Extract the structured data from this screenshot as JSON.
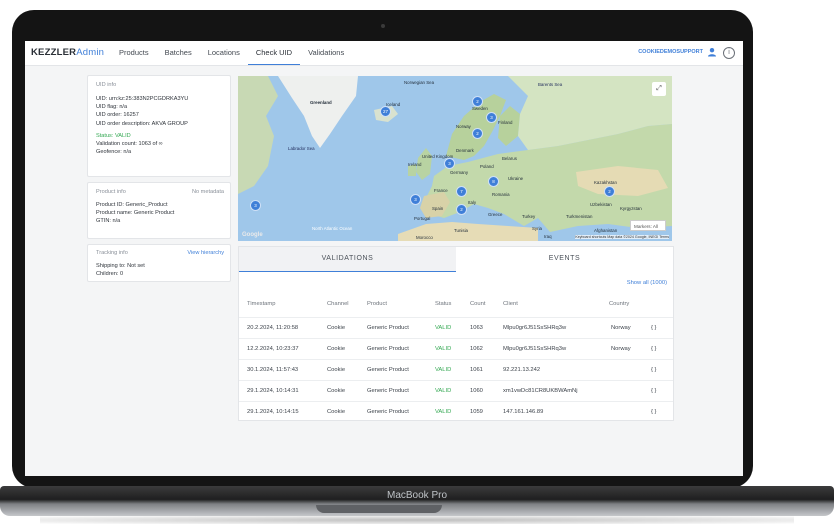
{
  "device": {
    "label": "MacBook Pro"
  },
  "header": {
    "logo_main": "KEZZLER",
    "logo_accent": "Admin",
    "nav": [
      "Products",
      "Batches",
      "Locations",
      "Check UID",
      "Validations"
    ],
    "active_nav": "Check UID",
    "user": "COOKIEDEMOSUPPORT"
  },
  "uid_info": {
    "title": "UID info",
    "uid": "UID: urn:kz:25:383N2PCGDRKA3YU",
    "flag": "UID flag: n/a",
    "order": "UID order: 16257",
    "order_desc": "UID order description: AKVA GROUP",
    "status": "Status: VALID",
    "validation_count": "Validation count: 1063 of ∞",
    "geofence": "Geofence: n/a"
  },
  "product_info": {
    "title": "Product info",
    "meta": "No metadata",
    "id": "Product ID: Generic_Product",
    "name": "Product name: Generic Product",
    "gtin": "GTIN: n/a"
  },
  "tracking_info": {
    "title": "Tracking info",
    "link": "View hierarchy",
    "shipping": "Shipping to: Not set",
    "children": "Children: 0"
  },
  "map": {
    "labels": [
      "Greenland",
      "Iceland",
      "Norwegian Sea",
      "Sweden",
      "Finland",
      "Norway",
      "Denmark",
      "United Kingdom",
      "Ireland",
      "Poland",
      "Belarus",
      "Germany",
      "Ukraine",
      "France",
      "Romania",
      "Kazakhstan",
      "Italy",
      "Spain",
      "Portugal",
      "Greece",
      "Turkey",
      "Turkmenistan",
      "Uzbekistan",
      "Kyrgyzstan",
      "Syria",
      "Iraq",
      "Afghanistan",
      "Tunisia",
      "Morocco",
      "North Atlantic Ocean",
      "Labrador Sea",
      "Barents Sea"
    ],
    "clusters": [
      "27",
      "2",
      "3",
      "2",
      "3",
      "7",
      "8",
      "2",
      "3",
      "3",
      "2"
    ],
    "markers_select": "Markers: All",
    "google": "Google",
    "attribution": "Keyboard shortcuts  Map data ©2024 Google, INEGI  Terms"
  },
  "tabs": [
    "VALIDATIONS",
    "EVENTS"
  ],
  "active_tab": "VALIDATIONS",
  "show_all": "Show all (1000)",
  "table": {
    "headers": [
      "Timestamp",
      "Channel",
      "Product",
      "Status",
      "Count",
      "Client",
      "Country",
      ""
    ],
    "rows": [
      [
        "20.2.2024, 11:20:58",
        "Cookie",
        "Generic Product",
        "VALID",
        "1063",
        "Mlpu0gr6J51SsSHRq3w",
        "Norway",
        "{ }"
      ],
      [
        "12.2.2024, 10:23:37",
        "Cookie",
        "Generic Product",
        "VALID",
        "1062",
        "Mlpu0gr6J51SsSHRq3w",
        "Norway",
        "{ }"
      ],
      [
        "30.1.2024, 11:57:43",
        "Cookie",
        "Generic Product",
        "VALID",
        "1061",
        "92.221.13.242",
        "",
        "{ }"
      ],
      [
        "29.1.2024, 10:14:31",
        "Cookie",
        "Generic Product",
        "VALID",
        "1060",
        "xm1vwDc81CR8UKBWAmNj",
        "",
        "{ }"
      ],
      [
        "29.1.2024, 10:14:15",
        "Cookie",
        "Generic Product",
        "VALID",
        "1059",
        "147.161.146.89",
        "",
        "{ }"
      ]
    ]
  },
  "colors": {
    "accent": "#3f7fd8",
    "valid": "#33a852",
    "frame": "#141414"
  }
}
